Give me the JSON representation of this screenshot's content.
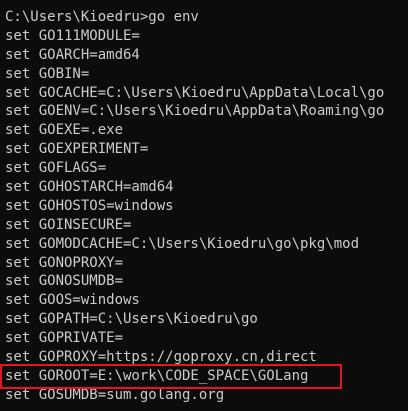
{
  "terminal": {
    "prompt_line": "C:\\Users\\Kioedru>go env",
    "lines": [
      "set GO111MODULE=",
      "set GOARCH=amd64",
      "set GOBIN=",
      "set GOCACHE=C:\\Users\\Kioedru\\AppData\\Local\\go",
      "set GOENV=C:\\Users\\Kioedru\\AppData\\Roaming\\go",
      "set GOEXE=.exe",
      "set GOEXPERIMENT=",
      "set GOFLAGS=",
      "set GOHOSTARCH=amd64",
      "set GOHOSTOS=windows",
      "set GOINSECURE=",
      "set GOMODCACHE=C:\\Users\\Kioedru\\go\\pkg\\mod",
      "set GONOPROXY=",
      "set GONOSUMDB=",
      "set GOOS=windows",
      "set GOPATH=C:\\Users\\Kioedru\\go",
      "set GOPRIVATE=",
      "set GOPROXY=https://goproxy.cn,direct",
      "set GOROOT=E:\\work\\CODE_SPACE\\GOLang",
      "set GOSUMDB=sum.golang.org"
    ]
  },
  "colors": {
    "background": "#0c0c0c",
    "text": "#cccccc",
    "highlight_border": "#e8131b"
  }
}
